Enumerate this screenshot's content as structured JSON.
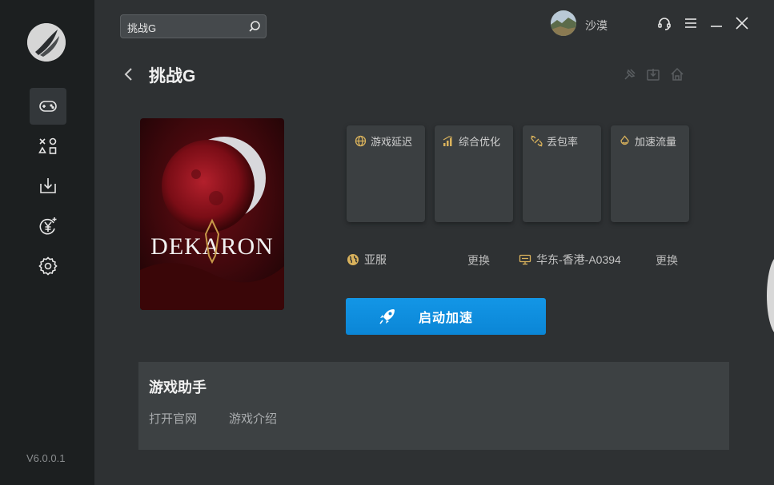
{
  "search": {
    "value": "挑战G"
  },
  "user": {
    "name": "沙漠"
  },
  "page": {
    "title": "挑战G"
  },
  "stats": [
    {
      "label": "游戏延迟",
      "icon": "globe-icon"
    },
    {
      "label": "综合优化",
      "icon": "signal-bars-icon"
    },
    {
      "label": "丢包率",
      "icon": "broken-link-icon"
    },
    {
      "label": "加速流量",
      "icon": "drop-icon"
    }
  ],
  "region": {
    "label": "亚服",
    "change": "更换"
  },
  "server": {
    "label": "华东-香港-A0394",
    "change": "更换"
  },
  "start_button": {
    "label": "启动加速"
  },
  "assistant": {
    "title": "游戏助手",
    "links": [
      "打开官网",
      "游戏介绍"
    ]
  },
  "version": "V6.0.0.1",
  "colors": {
    "accent": "#0f8fe0",
    "sidebar": "#1c1f20",
    "background": "#2e3133",
    "icon_gold": "#d9b25c"
  }
}
